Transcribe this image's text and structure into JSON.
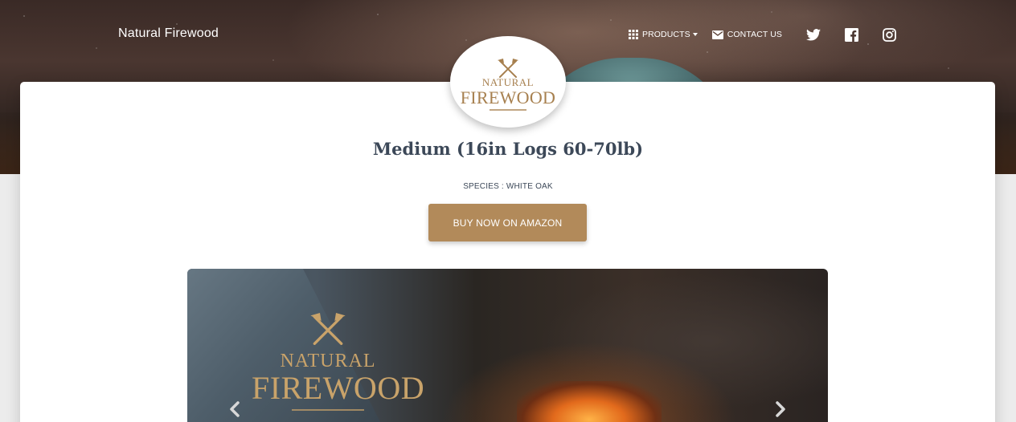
{
  "header": {
    "brand": "Natural Firewood",
    "nav": {
      "products_label": "PRODUCTS",
      "contact_label": "CONTACT US"
    },
    "social": [
      "twitter-icon",
      "facebook-icon",
      "instagram-icon"
    ]
  },
  "logo": {
    "line1": "NATURAL",
    "line2": "FIREWOOD"
  },
  "product": {
    "title": "Medium (16in Logs 60-70lb)",
    "species": "SPECIES : WHITE OAK",
    "buy_label": "BUY NOW ON AMAZON"
  },
  "carousel": {
    "logo_line1": "NATURAL",
    "logo_line2": "FIREWOOD"
  },
  "colors": {
    "accent": "#b28a5a",
    "title": "#3c4858",
    "logo_gold": "#a7804f"
  }
}
